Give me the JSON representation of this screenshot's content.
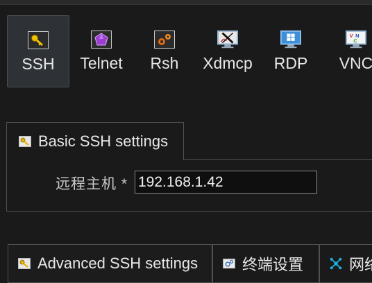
{
  "session_types": [
    {
      "label": "SSH",
      "icon": "key-icon",
      "selected": true
    },
    {
      "label": "Telnet",
      "icon": "purple-gem-icon",
      "selected": false
    },
    {
      "label": "Rsh",
      "icon": "gears-icon",
      "selected": false
    },
    {
      "label": "Xdmcp",
      "icon": "x-monitor-icon",
      "selected": false
    },
    {
      "label": "RDP",
      "icon": "windows-monitor-icon",
      "selected": false
    },
    {
      "label": "VNC",
      "icon": "vnc-monitor-icon",
      "selected": false
    }
  ],
  "basic_settings": {
    "tab_label": "Basic SSH settings",
    "remote_host_label": "远程主机 *",
    "remote_host_value": "192.168.1.42"
  },
  "bottom_tabs": [
    {
      "label": "Advanced SSH settings",
      "icon": "key-icon"
    },
    {
      "label": "终端设置",
      "icon": "terminal-settings-icon"
    },
    {
      "label": "网络设置",
      "icon": "network-icon"
    }
  ],
  "colors": {
    "background": "#1a1a1a",
    "selected_tile": "#2e3236",
    "border": "#505050",
    "key_icon_gold": "#e8b400"
  }
}
